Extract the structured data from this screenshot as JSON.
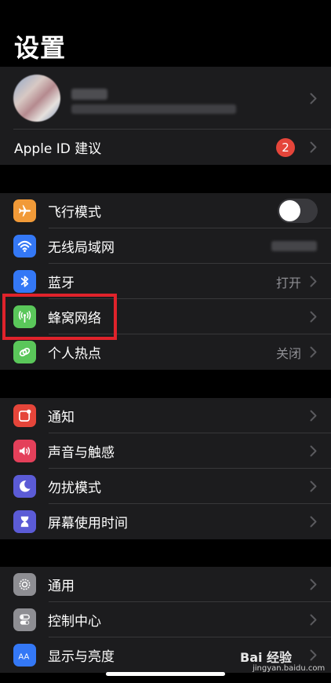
{
  "page_title": "设置",
  "profile": {
    "avatar_icon": "avatar-blurred",
    "name_blurred": true,
    "subtitle_blurred": true
  },
  "apple_id": {
    "label": "Apple ID 建议",
    "badge": "2"
  },
  "connectivity": [
    {
      "key": "airplane",
      "label": "飞行模式",
      "icon": "airplane-icon",
      "color": "#f19a38",
      "toggle": false
    },
    {
      "key": "wifi",
      "label": "无线局域网",
      "icon": "wifi-icon",
      "color": "#3478f6",
      "value_blurred": true
    },
    {
      "key": "bluetooth",
      "label": "蓝牙",
      "icon": "bluetooth-icon",
      "color": "#3478f6",
      "value": "打开"
    },
    {
      "key": "cellular",
      "label": "蜂窝网络",
      "icon": "cellular-antenna-icon",
      "color": "#5ac75a",
      "value": ""
    },
    {
      "key": "hotspot",
      "label": "个人热点",
      "icon": "hotspot-link-icon",
      "color": "#5ac75a",
      "value": "关闭"
    }
  ],
  "notifications_group": [
    {
      "key": "notifications",
      "label": "通知",
      "icon": "notification-icon",
      "color": "#e5453a"
    },
    {
      "key": "sounds",
      "label": "声音与触感",
      "icon": "speaker-icon",
      "color": "#e4405a"
    },
    {
      "key": "dnd",
      "label": "勿扰模式",
      "icon": "moon-icon",
      "color": "#5b5bd6"
    },
    {
      "key": "screentime",
      "label": "屏幕使用时间",
      "icon": "hourglass-icon",
      "color": "#5b5bd6"
    }
  ],
  "general_group": [
    {
      "key": "general",
      "label": "通用",
      "icon": "gear-icon",
      "color": "#8e8e93"
    },
    {
      "key": "control",
      "label": "控制中心",
      "icon": "switches-icon",
      "color": "#8e8e93"
    },
    {
      "key": "display",
      "label": "显示与亮度",
      "icon": "text-size-icon",
      "color": "#3478f6"
    }
  ],
  "watermark": {
    "text": "Bai 经验",
    "sub": "jingyan.baidu.com"
  }
}
